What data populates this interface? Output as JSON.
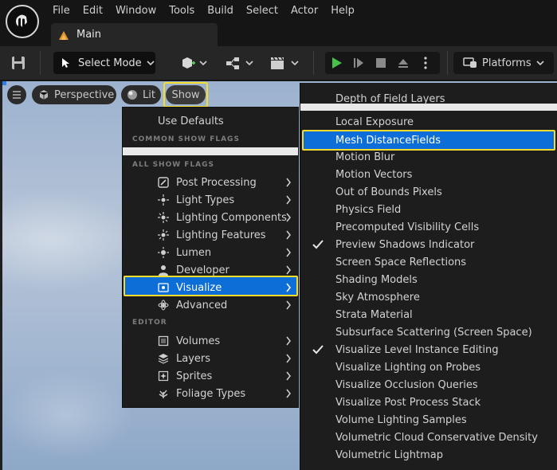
{
  "menu": [
    "File",
    "Edit",
    "Window",
    "Tools",
    "Build",
    "Select",
    "Actor",
    "Help"
  ],
  "tab": {
    "label": "Main"
  },
  "toolbar": {
    "select_mode": "Select Mode",
    "platforms": "Platforms"
  },
  "viewport": {
    "perspective": "Perspective",
    "lit": "Lit",
    "show": "Show"
  },
  "show_menu": {
    "use_defaults": "Use Defaults",
    "section_common": "COMMON SHOW FLAGS",
    "section_all": "ALL SHOW FLAGS",
    "section_editor": "EDITOR",
    "all_flags": [
      {
        "label": "Post Processing",
        "icon": "post-processing-icon"
      },
      {
        "label": "Light Types",
        "icon": "light-types-icon"
      },
      {
        "label": "Lighting Components",
        "icon": "lighting-components-icon"
      },
      {
        "label": "Lighting Features",
        "icon": "lighting-features-icon"
      },
      {
        "label": "Lumen",
        "icon": "lumen-icon"
      },
      {
        "label": "Developer",
        "icon": "developer-icon"
      },
      {
        "label": "Visualize",
        "icon": "visualize-icon",
        "selected": true
      },
      {
        "label": "Advanced",
        "icon": "advanced-icon"
      }
    ],
    "editor_flags": [
      {
        "label": "Volumes",
        "icon": "volumes-icon"
      },
      {
        "label": "Layers",
        "icon": "layers-icon"
      },
      {
        "label": "Sprites",
        "icon": "sprites-icon"
      },
      {
        "label": "Foliage Types",
        "icon": "foliage-icon"
      }
    ]
  },
  "visualize_menu": {
    "items": [
      {
        "label": "Depth of Field Layers",
        "checked": false
      },
      {
        "label": "Local Exposure",
        "checked": false
      },
      {
        "label": "Mesh DistanceFields",
        "checked": false,
        "selected": true
      },
      {
        "label": "Motion Blur",
        "checked": false
      },
      {
        "label": "Motion Vectors",
        "checked": false
      },
      {
        "label": "Out of Bounds Pixels",
        "checked": false
      },
      {
        "label": "Physics Field",
        "checked": false
      },
      {
        "label": "Precomputed Visibility Cells",
        "checked": false
      },
      {
        "label": "Preview Shadows Indicator",
        "checked": true
      },
      {
        "label": "Screen Space Reflections",
        "checked": false
      },
      {
        "label": "Shading Models",
        "checked": false
      },
      {
        "label": "Sky Atmosphere",
        "checked": false
      },
      {
        "label": "Strata Material",
        "checked": false
      },
      {
        "label": "Subsurface Scattering (Screen Space)",
        "checked": false
      },
      {
        "label": "Visualize Level Instance Editing",
        "checked": true
      },
      {
        "label": "Visualize Lighting on Probes",
        "checked": false
      },
      {
        "label": "Visualize Occlusion Queries",
        "checked": false
      },
      {
        "label": "Visualize Post Process Stack",
        "checked": false
      },
      {
        "label": "Volume Lighting Samples",
        "checked": false
      },
      {
        "label": "Volumetric Cloud Conservative Density",
        "checked": false
      },
      {
        "label": "Volumetric Lightmap",
        "checked": false
      }
    ]
  },
  "colors": {
    "accent": "#0e6ed8",
    "highlight": "#f3dc2b",
    "play": "#46c24b"
  }
}
